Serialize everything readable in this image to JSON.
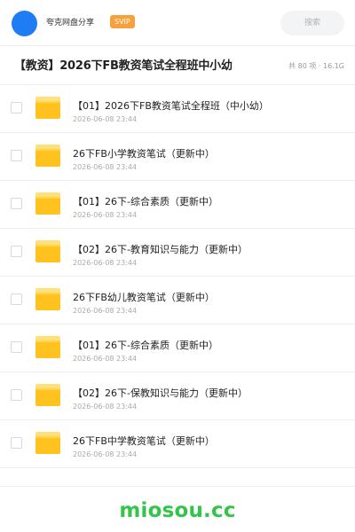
{
  "header": {
    "user_name": "夸克网盘分享",
    "badge": "SVIP",
    "search_placeholder": "搜索"
  },
  "title_bar": {
    "title": "【教资】2026下FB教资笔试全程班中小幼",
    "meta": "共 80 项 · 16.1G"
  },
  "files": [
    {
      "name": "【01】2026下FB教资笔试全程班（中小幼）",
      "date": "2026-06-08 23:44"
    },
    {
      "name": "26下FB小学教资笔试（更新中）",
      "date": "2026-06-08 23:44"
    },
    {
      "name": "【01】26下-综合素质（更新中）",
      "date": "2026-06-08 23:44"
    },
    {
      "name": "【02】26下-教育知识与能力（更新中）",
      "date": "2026-06-08 23:44"
    },
    {
      "name": "26下FB幼儿教资笔试（更新中）",
      "date": "2026-06-08 23:44"
    },
    {
      "name": "【01】26下-综合素质（更新中）",
      "date": "2026-06-08 23:44"
    },
    {
      "name": "【02】26下-保教知识与能力（更新中）",
      "date": "2026-06-08 23:44"
    },
    {
      "name": "26下FB中学教资笔试（更新中）",
      "date": "2026-06-08 23:44"
    }
  ],
  "footer": {
    "brand": "miosou.cc"
  },
  "colors": {
    "avatar": "#1e7cf5",
    "badge": "#f7a13c",
    "folder": "#ffc21e",
    "brand": "#33c44a"
  },
  "icons": {
    "folder": "folder-icon",
    "avatar": "avatar"
  }
}
